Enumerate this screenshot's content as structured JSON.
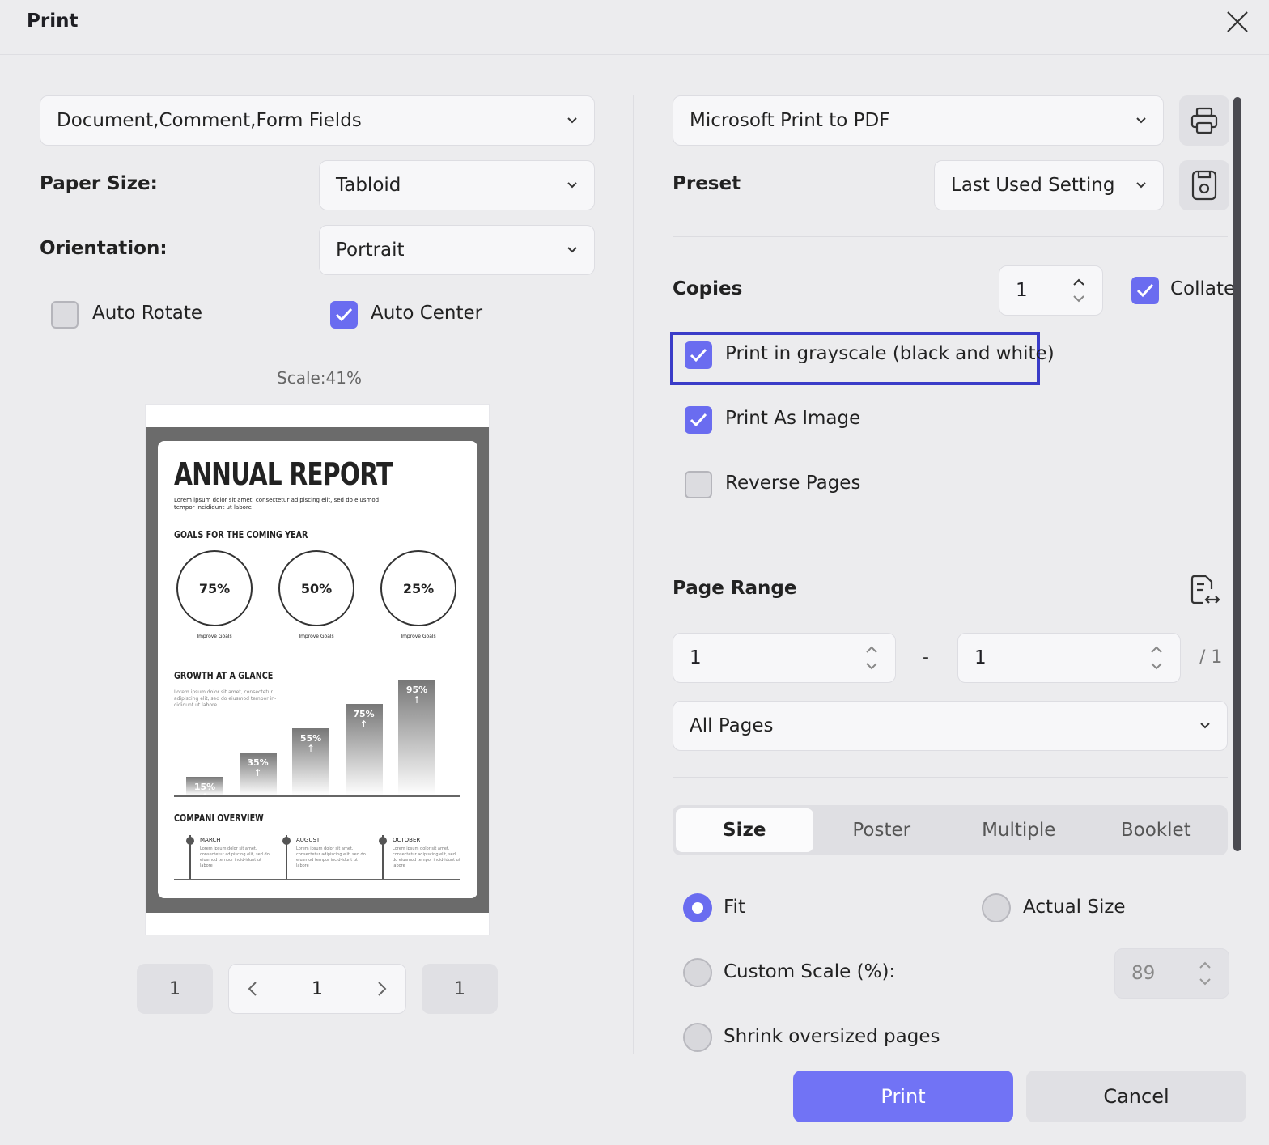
{
  "dialog": {
    "title": "Print"
  },
  "left": {
    "content_select": "Document,Comment,Form Fields",
    "paper_size_label": "Paper Size:",
    "paper_size_value": "Tabloid",
    "orientation_label": "Orientation:",
    "orientation_value": "Portrait",
    "auto_rotate": {
      "label": "Auto Rotate",
      "checked": false
    },
    "auto_center": {
      "label": "Auto Center",
      "checked": true
    },
    "scale_text": "Scale:41%",
    "pager": {
      "first": "1",
      "current": "1",
      "last": "1"
    }
  },
  "preview": {
    "title": "ANNUAL REPORT",
    "intro": "Lorem ipsum dolor sit amet, consectetur adipiscing elit, sed do eiusmod tempor incididunt ut labore",
    "goals_heading": "GOALS FOR THE COMING YEAR",
    "goals": [
      {
        "value": "75%",
        "label": "Improve Goals"
      },
      {
        "value": "50%",
        "label": "Improve Goals"
      },
      {
        "value": "25%",
        "label": "Improve Goals"
      }
    ],
    "growth_heading": "GROWTH AT A GLANCE",
    "growth_text": "Lorem ipsum dolor sit amet, consectetur adipiscing elit, sed do eiusmod tempor in-cididunt ut labore",
    "bars": [
      {
        "label": "15%",
        "value": 15
      },
      {
        "label": "35%",
        "value": 35
      },
      {
        "label": "55%",
        "value": 55
      },
      {
        "label": "75%",
        "value": 75
      },
      {
        "label": "95%",
        "value": 95
      }
    ],
    "overview_heading": "COMPANI OVERVIEW",
    "timeline": [
      {
        "month": "MARCH",
        "text": "Lorem ipsum dolor sit amet, consectetur adipiscing elit, sed do eiusmod tempor incid-idunt ut labore"
      },
      {
        "month": "AUGUST",
        "text": "Lorem ipsum dolor sit amet, consectetur adipiscing elit, sed do eiusmod tempor incid-idunt ut labore"
      },
      {
        "month": "OCTOBER",
        "text": "Lorem ipsum dolor sit amet, consectetur adipiscing elit, sed do eiusmod tempor incid-idunt ut labore"
      }
    ]
  },
  "right": {
    "printer": "Microsoft Print to PDF",
    "preset_label": "Preset",
    "preset_value": "Last Used Setting",
    "copies_label": "Copies",
    "copies_value": "1",
    "collate": {
      "label": "Collate",
      "checked": true
    },
    "grayscale": {
      "label": "Print in grayscale (black and white)",
      "checked": true
    },
    "as_image": {
      "label": "Print As Image",
      "checked": true
    },
    "reverse": {
      "label": "Reverse Pages",
      "checked": false
    },
    "page_range_label": "Page Range",
    "range_from": "1",
    "range_dash": "-",
    "range_to": "1",
    "range_total": "/ 1",
    "pages_select": "All Pages",
    "tabs": [
      "Size",
      "Poster",
      "Multiple",
      "Booklet"
    ],
    "fit_label": "Fit",
    "actual_size_label": "Actual Size",
    "custom_scale_label": "Custom Scale (%):",
    "custom_scale_value": "89",
    "shrink_label": "Shrink oversized pages",
    "print_button": "Print",
    "cancel_button": "Cancel"
  },
  "colors": {
    "accent": "#6a6cf0",
    "highlight": "#3a3cc8",
    "print_button": "#7173f5"
  }
}
